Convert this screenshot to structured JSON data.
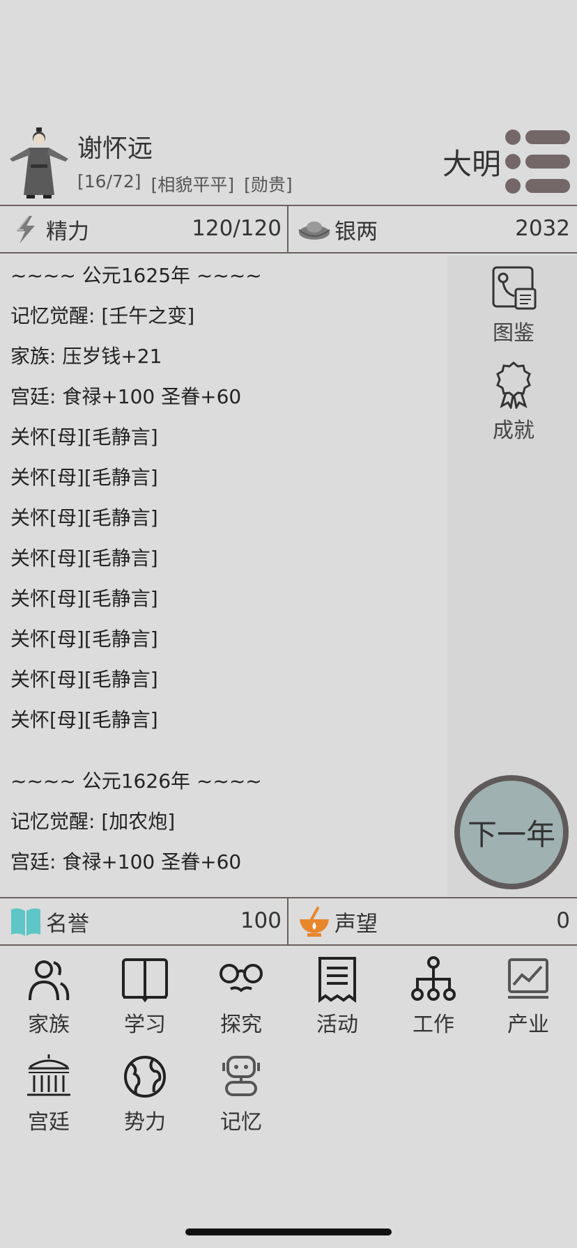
{
  "header": {
    "name": "谢怀远",
    "tags": [
      "[16/72]",
      "[相貌平平]",
      "[勋贵]"
    ],
    "dynasty": "大明"
  },
  "stats_top": {
    "energy": {
      "label": "精力",
      "value": "120/120"
    },
    "silver": {
      "label": "银两",
      "value": "2032"
    }
  },
  "log": {
    "year1": "~~~~ 公元1625年 ~~~~",
    "lines1": [
      "记忆觉醒: [壬午之变]",
      "家族: 压岁钱+21",
      "宫廷: 食禄+100  圣眷+60",
      "关怀[母][毛静言]",
      "关怀[母][毛静言]",
      "关怀[母][毛静言]",
      "关怀[母][毛静言]",
      "关怀[母][毛静言]",
      "关怀[母][毛静言]",
      "关怀[母][毛静言]",
      "关怀[母][毛静言]"
    ],
    "year2": "~~~~ 公元1626年 ~~~~",
    "lines2": [
      "记忆觉醒: [加农炮]",
      "宫廷: 食禄+100  圣眷+60"
    ]
  },
  "side": {
    "collection_label": "图鉴",
    "achievement_label": "成就",
    "next_year_label": "下一年"
  },
  "stats_bottom": {
    "honor": {
      "label": "名誉",
      "value": "100"
    },
    "prestige": {
      "label": "声望",
      "value": "0"
    }
  },
  "nav": {
    "items": [
      {
        "label": "家族",
        "icon": "family-icon"
      },
      {
        "label": "学习",
        "icon": "book-icon"
      },
      {
        "label": "探究",
        "icon": "glasses-icon"
      },
      {
        "label": "活动",
        "icon": "receipt-icon"
      },
      {
        "label": "工作",
        "icon": "org-chart-icon"
      },
      {
        "label": "产业",
        "icon": "chart-icon"
      },
      {
        "label": "宫廷",
        "icon": "palace-icon"
      },
      {
        "label": "势力",
        "icon": "globe-icon"
      },
      {
        "label": "记忆",
        "icon": "robot-icon"
      }
    ]
  },
  "colors": {
    "background": "#dcdcdc",
    "divider": "#6b5f5f",
    "next_button": "#9fb1b1",
    "honor_book": "#5ec6c6",
    "prestige_bowl": "#e8862c"
  }
}
